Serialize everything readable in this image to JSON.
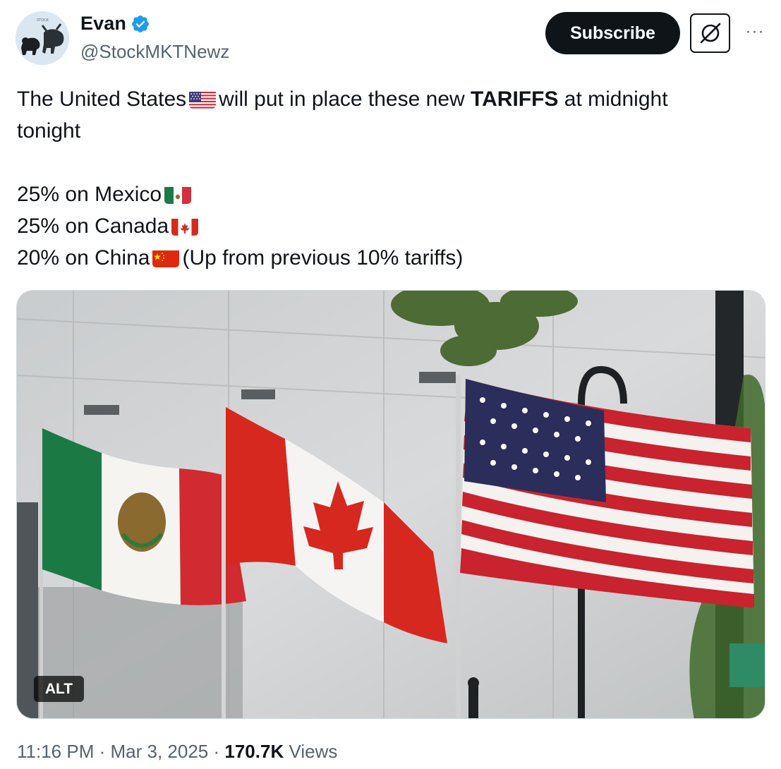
{
  "author": {
    "display_name": "Evan",
    "handle": "@StockMKTNewz",
    "verified": true,
    "accent_color": "#1d9bf0"
  },
  "actions": {
    "subscribe_label": "Subscribe",
    "grok_icon": "grok-icon",
    "more_icon": "more-icon",
    "more_label": "···"
  },
  "post": {
    "line1_a": "The United States",
    "line1_b": "will put in place these new",
    "line1_bold": "TARIFFS",
    "line1_c": "at midnight",
    "line2": "tonight",
    "mexico": "25% on Mexico",
    "canada": "25% on Canada",
    "china": "20% on China",
    "china_note": "(Up from previous 10% tariffs)"
  },
  "media": {
    "alt_label": "ALT"
  },
  "meta": {
    "time": "11:16 PM",
    "sep1": "·",
    "date": "Mar 3, 2025",
    "sep2": "·",
    "views_count": "170.7K",
    "views_label": "Views"
  },
  "colors": {
    "text_primary": "#0f1419",
    "text_secondary": "#536471",
    "button_dark": "#0f1419"
  }
}
